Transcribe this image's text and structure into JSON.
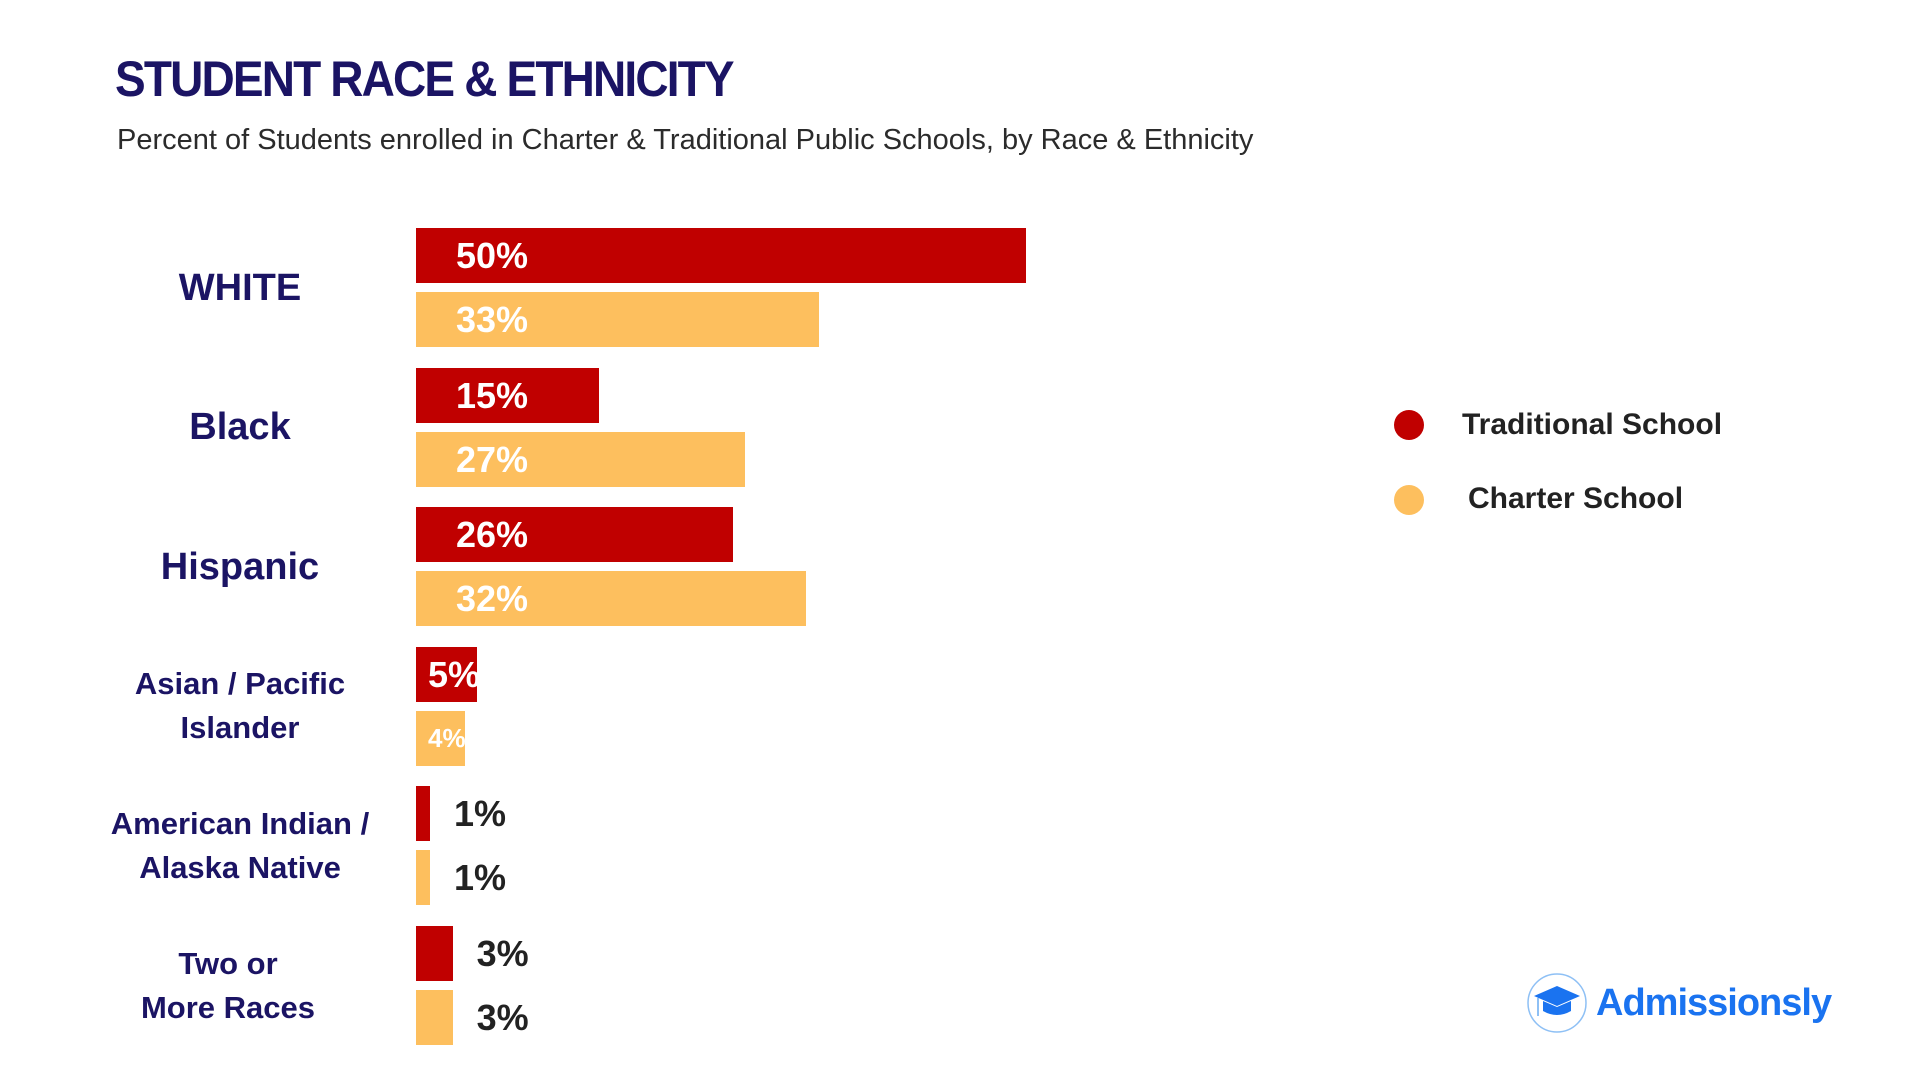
{
  "header": {
    "title": "STUDENT RACE & ETHNICITY",
    "subtitle": "Percent of Students enrolled in Charter & Traditional Public Schools, by Race & Ethnicity"
  },
  "chart_data": {
    "type": "bar",
    "orientation": "horizontal",
    "title": "STUDENT RACE & ETHNICITY",
    "subtitle": "Percent of Students enrolled in Charter & Traditional Public Schools, by Race & Ethnicity",
    "categories": [
      [
        "WHITE"
      ],
      [
        "Black"
      ],
      [
        "Hispanic"
      ],
      [
        "Asian / Pacific",
        "Islander"
      ],
      [
        "American Indian /",
        "Alaska Native"
      ],
      [
        "Two or",
        "More Races"
      ]
    ],
    "series": [
      {
        "name": "Traditional School",
        "color": "#c00000",
        "values": [
          50,
          15,
          26,
          5,
          1,
          3
        ],
        "labels": [
          "50%",
          "15%",
          "26%",
          "5%",
          "1%",
          "3%"
        ]
      },
      {
        "name": "Charter School",
        "color": "#fdbf5e",
        "values": [
          33,
          27,
          32,
          4,
          1,
          3
        ],
        "labels": [
          "33%",
          "27%",
          "32%",
          "4%",
          "1%",
          "3%"
        ]
      }
    ],
    "legend_position": "right",
    "grid": false,
    "xlim": [
      0,
      50
    ]
  },
  "brand": {
    "name": "Admissionsly",
    "icon": "graduation-cap-icon",
    "color": "#1a73f0"
  }
}
